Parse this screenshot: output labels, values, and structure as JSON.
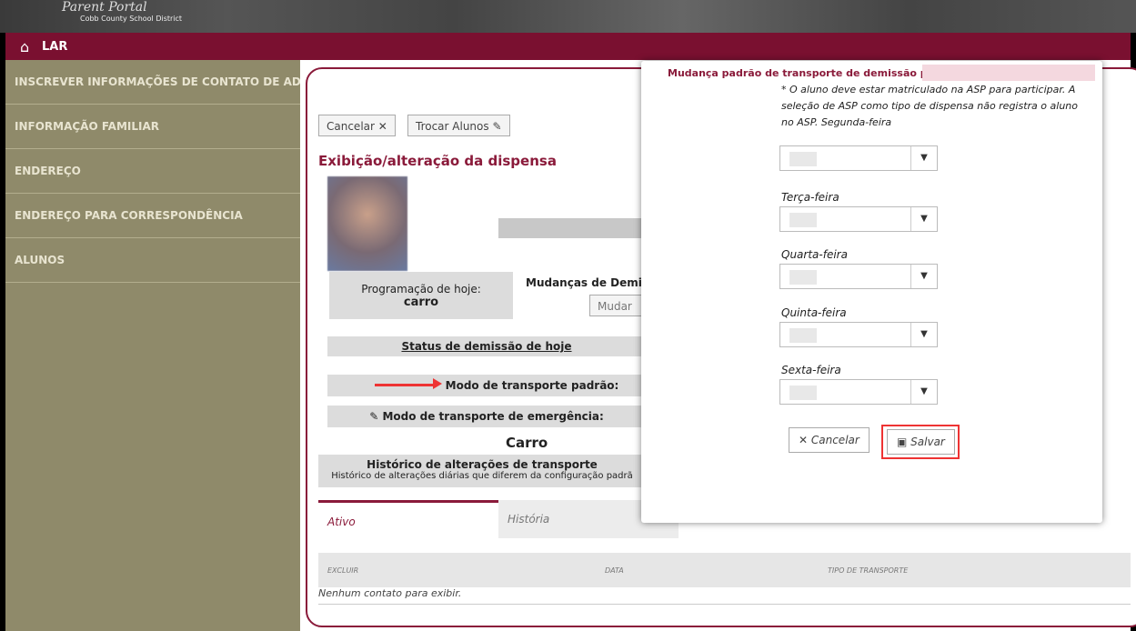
{
  "header": {
    "logo_text": "Parent Portal",
    "district": "Cobb County School District",
    "home_label": "LAR"
  },
  "sidebar": {
    "items": [
      {
        "label": "INSCREVER INFORMAÇÕES DE CONTATO DE ADULTOS"
      },
      {
        "label": "INFORMAÇÃO FAMILIAR"
      },
      {
        "label": "ENDEREÇO"
      },
      {
        "label": "ENDEREÇO PARA CORRESPONDÊNCIA"
      },
      {
        "label": "ALUNOS"
      }
    ]
  },
  "main": {
    "cancel_label": "Cancelar ✕",
    "swap_label": "Trocar Alunos",
    "section_title": "Exibição/alteração da dispensa",
    "today_schedule_label": "Programação de hoje:",
    "today_schedule_value": "carro",
    "dismissal_changes_label": "Mudanças de Demissã",
    "change_button": "Mudar",
    "today_status": "Status de demissão de hoje",
    "default_mode": "Modo de transporte padrão:",
    "emergency_mode": "Modo de transporte de emergência:",
    "emergency_value": "Carro",
    "history_title": "Histórico de alterações de transporte",
    "history_sub": "Histórico de alterações diárias que diferem da configuração padrã",
    "tabs": [
      {
        "label": "Ativo"
      },
      {
        "label": "História"
      }
    ],
    "table_headers": [
      "EXCLUIR",
      "DATA",
      "TIPO DE TRANSPORTE"
    ],
    "empty_text": "Nenhum contato para exibir."
  },
  "modal": {
    "title": "Mudança padrão de transporte de demissão para",
    "note": "* O aluno deve estar matriculado na ASP para participar. A seleção de ASP como tipo de dispensa não registra o aluno no ASP. Segunda-feira",
    "days": [
      {
        "label": "Terça-feira"
      },
      {
        "label": "Quarta-feira"
      },
      {
        "label": "Quinta-feira"
      },
      {
        "label": "Sexta-feira"
      }
    ],
    "cancel_label": "✕ Cancelar",
    "save_label": "Salvar"
  },
  "colors": {
    "brand": "#8a1a3a",
    "sidebar": "#8f8a6a",
    "annotation": "#ee3333"
  }
}
